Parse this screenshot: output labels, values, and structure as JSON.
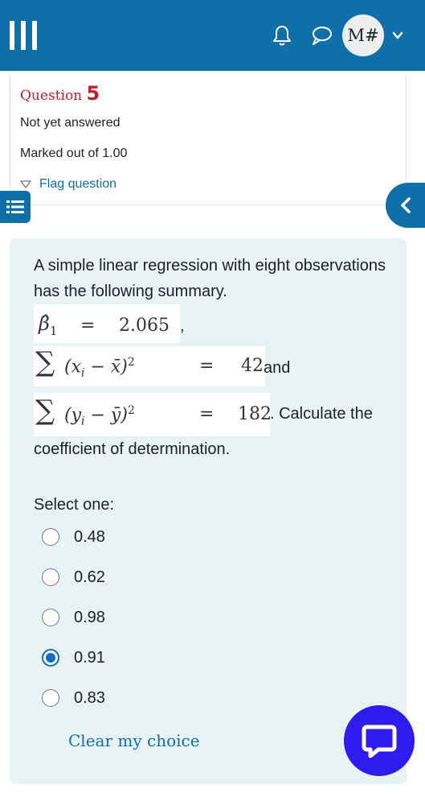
{
  "navbar": {
    "avatar_initials": "M#",
    "icons": [
      "hamburger-menu-icon",
      "bell-icon",
      "chat-bubble-icon",
      "chevron-down-icon"
    ],
    "background_color": "#0f6fa8"
  },
  "question_info": {
    "label": "Question",
    "number": "5",
    "state": "Not yet answered",
    "grade": "Marked out of 1.00",
    "flag_label": "Flag question",
    "title_color": "#c0202a"
  },
  "question": {
    "intro": "A simple linear regression with eight observations has the following summary.",
    "beta_value": "2.065",
    "sum_x_value": "42",
    "and_text": "and",
    "sum_y_value": "182",
    "calc_text": ". Calculate the",
    "tail_text": "coefficient of determination.",
    "prompt": "Select one:",
    "options": [
      {
        "label": "0.48",
        "selected": false
      },
      {
        "label": "0.62",
        "selected": false
      },
      {
        "label": "0.98",
        "selected": false
      },
      {
        "label": "0.91",
        "selected": true
      },
      {
        "label": "0.83",
        "selected": false
      }
    ],
    "clear_label": "Clear my choice"
  },
  "colors": {
    "accent": "#0f6fa8",
    "content_bg": "#e7f3f5",
    "radio_selected": "#0f6cbf",
    "chat_fab": "#2f1bf0"
  }
}
